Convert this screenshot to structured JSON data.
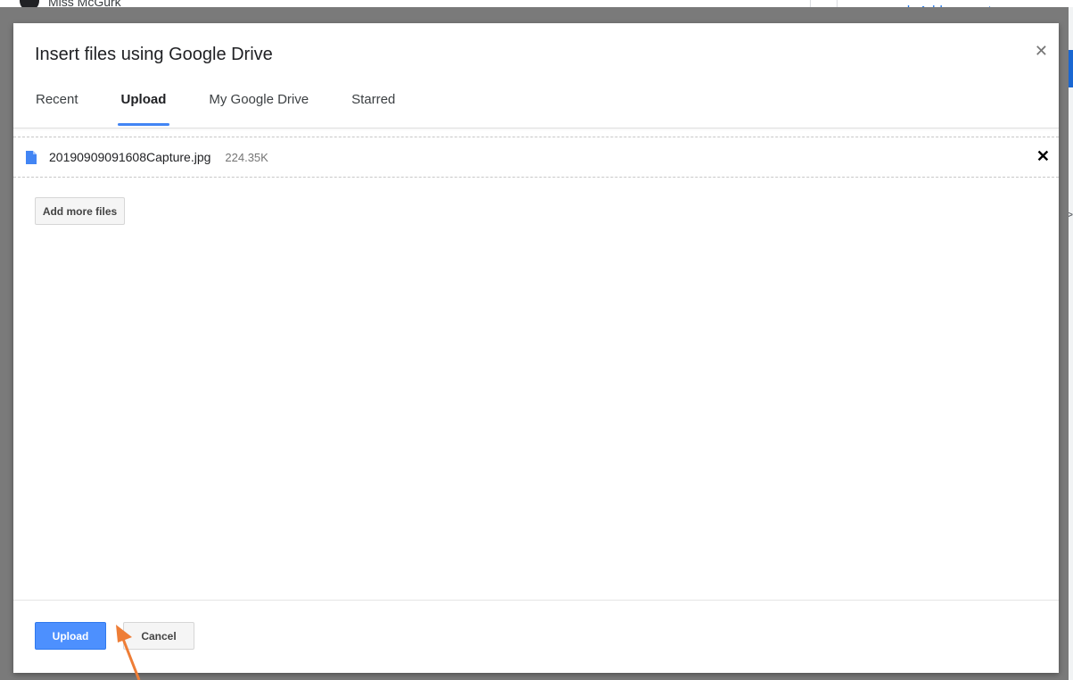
{
  "background": {
    "user_name": "Miss McGurk",
    "add_or_create": "Add or create"
  },
  "dialog": {
    "title": "Insert files using Google Drive",
    "close_icon": "close-icon",
    "tabs": [
      {
        "label": "Recent",
        "active": false
      },
      {
        "label": "Upload",
        "active": true
      },
      {
        "label": "My Google Drive",
        "active": false
      },
      {
        "label": "Starred",
        "active": false
      }
    ],
    "file": {
      "icon": "file-icon",
      "name": "20190909091608Capture.jpg",
      "size": "224.35K"
    },
    "add_more_label": "Add more files",
    "upload_label": "Upload",
    "cancel_label": "Cancel"
  },
  "colors": {
    "accent": "#4285f4",
    "upload_button": "#4d90fe",
    "annotation_arrow": "#ee7d36",
    "overlay": "#7a7a7a"
  }
}
